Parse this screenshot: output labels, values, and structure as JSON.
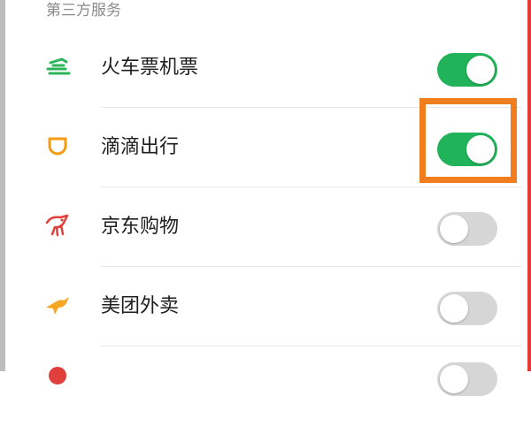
{
  "section": {
    "title": "第三方服务"
  },
  "colors": {
    "toggle_on": "#21b35a",
    "toggle_off": "#d6d6d6",
    "highlight": "#f07d1e"
  },
  "services": [
    {
      "label": "火车票机票",
      "icon": "train-ticket-icon",
      "enabled": true
    },
    {
      "label": "滴滴出行",
      "icon": "didi-icon",
      "enabled": true
    },
    {
      "label": "京东购物",
      "icon": "jd-dog-icon",
      "enabled": false
    },
    {
      "label": "美团外卖",
      "icon": "meituan-kangaroo-icon",
      "enabled": false
    },
    {
      "label": "",
      "icon": "map-pin-icon",
      "enabled": false
    }
  ]
}
